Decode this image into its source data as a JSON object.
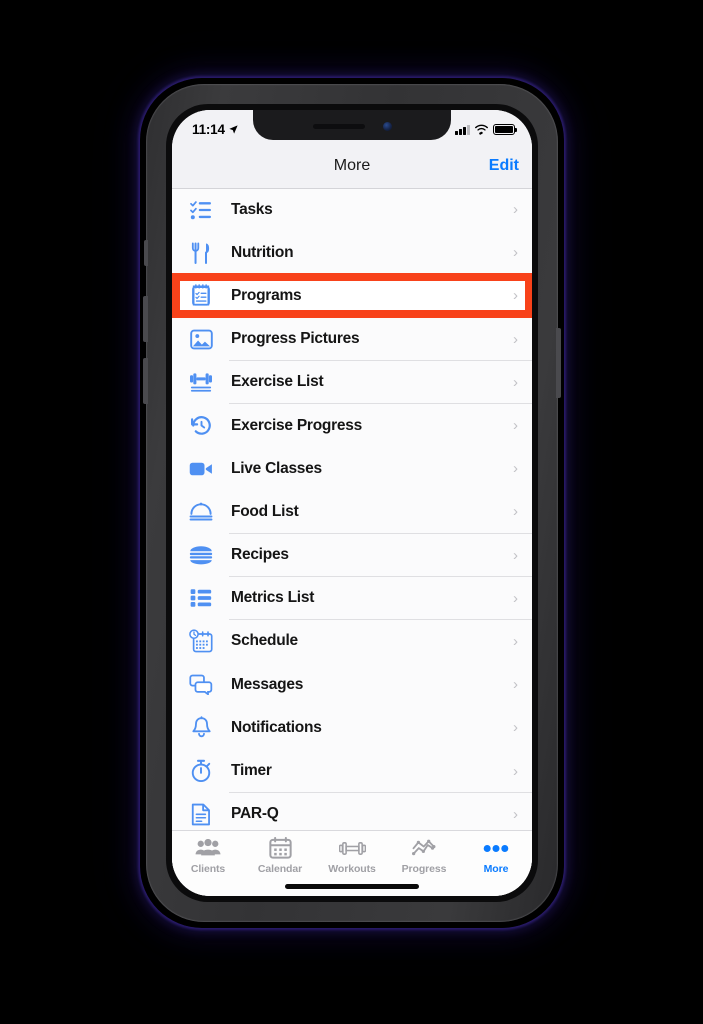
{
  "device": {
    "frame": "iphone-x",
    "bezel_color": "#37373a",
    "glow_color": "#2d1e78"
  },
  "statusbar": {
    "time": "11:14",
    "location_icon": "location-arrow-icon",
    "cellular_icon": "cellular-bars-icon",
    "cellular_bars_filled": 3,
    "cellular_bars_total": 4,
    "wifi_icon": "wifi-icon",
    "battery_icon": "battery-full-icon"
  },
  "navbar": {
    "title": "More",
    "edit_label": "Edit",
    "accent_color": "#0a7bff"
  },
  "highlight": {
    "target_label": "Programs",
    "color": "#f8421a"
  },
  "list": {
    "icon_color": "#4f90f2",
    "items": [
      {
        "label": "Tasks",
        "icon": "checklist-icon",
        "highlighted": false
      },
      {
        "label": "Nutrition",
        "icon": "fork-knife-icon",
        "highlighted": false
      },
      {
        "label": "Programs",
        "icon": "notepad-list-icon",
        "highlighted": true
      },
      {
        "label": "Progress Pictures",
        "icon": "photo-icon",
        "highlighted": false
      },
      {
        "label": "Exercise List",
        "icon": "dumbbell-icon",
        "highlighted": false
      },
      {
        "label": "Exercise Progress",
        "icon": "history-clock-icon",
        "highlighted": false
      },
      {
        "label": "Live Classes",
        "icon": "video-camera-icon",
        "highlighted": false
      },
      {
        "label": "Food List",
        "icon": "food-cloche-icon",
        "highlighted": false
      },
      {
        "label": "Recipes",
        "icon": "burger-icon",
        "highlighted": false
      },
      {
        "label": "Metrics List",
        "icon": "bulleted-list-icon",
        "highlighted": false
      },
      {
        "label": "Schedule",
        "icon": "calendar-clock-icon",
        "highlighted": false
      },
      {
        "label": "Messages",
        "icon": "chat-bubbles-icon",
        "highlighted": false
      },
      {
        "label": "Notifications",
        "icon": "bell-icon",
        "highlighted": false
      },
      {
        "label": "Timer",
        "icon": "stopwatch-icon",
        "highlighted": false
      },
      {
        "label": "PAR-Q",
        "icon": "document-icon",
        "highlighted": false
      }
    ],
    "chevron": "›"
  },
  "tabbar": {
    "active_index": 4,
    "tabs": [
      {
        "label": "Clients",
        "icon": "people-group-icon"
      },
      {
        "label": "Calendar",
        "icon": "calendar-icon"
      },
      {
        "label": "Workouts",
        "icon": "dumbbell-icon"
      },
      {
        "label": "Progress",
        "icon": "line-chart-icon"
      },
      {
        "label": "More",
        "icon": "ellipsis-icon"
      }
    ]
  }
}
